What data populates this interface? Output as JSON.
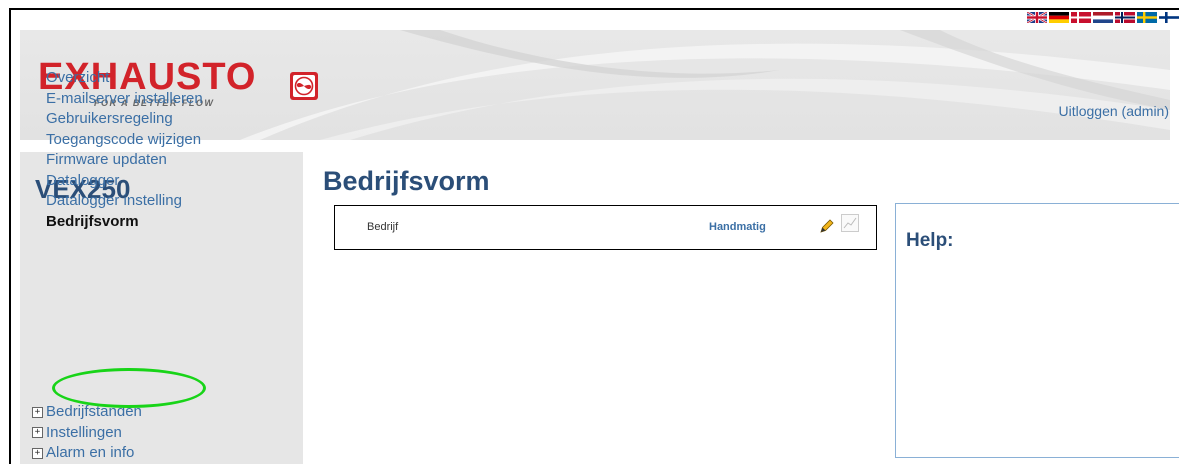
{
  "header": {
    "brand": "EXHAUSTO",
    "tagline": "FOR A BETTER FLOW",
    "logout_label": "Uitloggen (admin)",
    "flags": [
      "uk-flag",
      "de-flag",
      "dk-flag",
      "nl-flag",
      "no-flag",
      "se-flag",
      "fi-flag"
    ]
  },
  "sidebar": {
    "model": "VEX250",
    "items": [
      {
        "label": "Overzicht"
      },
      {
        "label": "E-mailserver installeren"
      },
      {
        "label": "Gebruikersregeling"
      },
      {
        "label": "Toegangscode wijzigen"
      },
      {
        "label": "Firmware updaten"
      },
      {
        "label": "Datalogger"
      },
      {
        "label": "Datalogger instelling"
      },
      {
        "label": "Bedrijfsvorm",
        "active": true
      }
    ],
    "groups": [
      {
        "label": "Bedrijfstanden"
      },
      {
        "label": "Instellingen"
      },
      {
        "label": "Alarm en info"
      }
    ]
  },
  "main": {
    "title": "Bedrijfsvorm",
    "field": {
      "label": "Bedrijf",
      "mode": "Handmatig"
    }
  },
  "help": {
    "title": "Help:"
  },
  "colors": {
    "brand_red": "#d2232a",
    "title_blue": "#2b4e78",
    "link_blue": "#3b6fa5",
    "highlight_green": "#18d418"
  }
}
